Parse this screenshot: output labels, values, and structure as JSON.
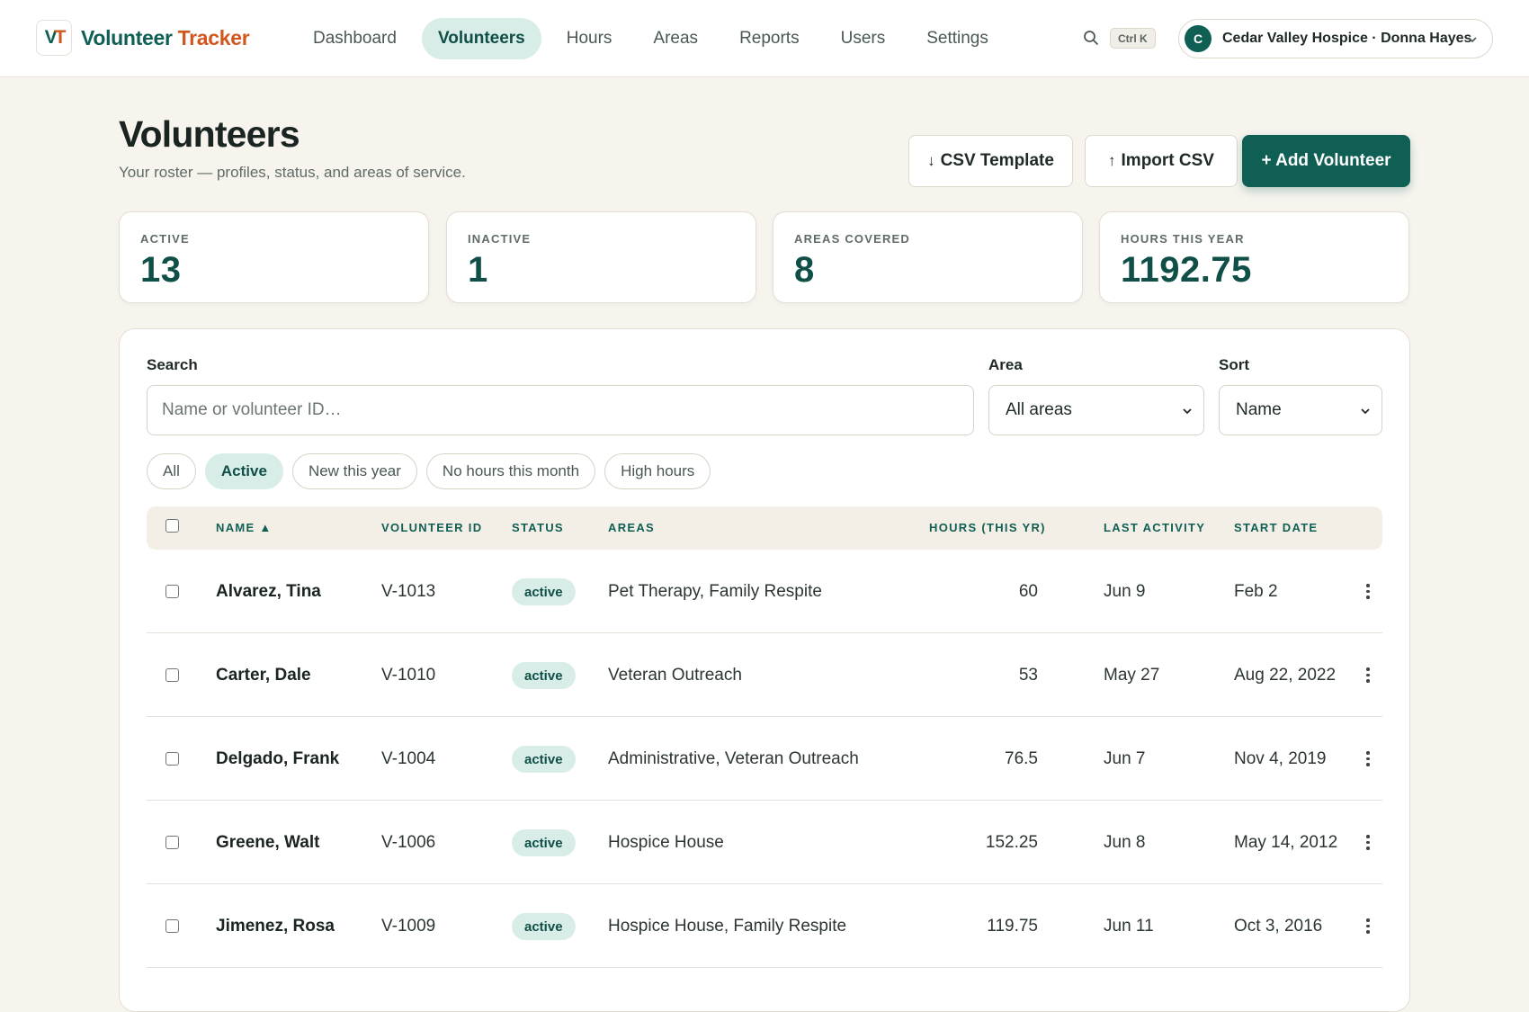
{
  "brand": {
    "logo_v": "V",
    "logo_t": "T",
    "name_a": "Volunteer",
    "name_b": "Tracker"
  },
  "nav": [
    "Dashboard",
    "Volunteers",
    "Hours",
    "Areas",
    "Reports",
    "Users",
    "Settings"
  ],
  "nav_active": "Volunteers",
  "shortcut": "Ctrl K",
  "org": {
    "initial": "C",
    "label": "Cedar Valley Hospice · Donna Hayes"
  },
  "header": {
    "title": "Volunteers",
    "subtitle": "Your roster — profiles, status, and areas of service."
  },
  "actions": {
    "csv_template": "CSV Template",
    "import_csv": "Import CSV",
    "add_volunteer": "+ Add Volunteer"
  },
  "stats": [
    {
      "label": "ACTIVE",
      "value": "13"
    },
    {
      "label": "INACTIVE",
      "value": "1"
    },
    {
      "label": "AREAS COVERED",
      "value": "8"
    },
    {
      "label": "HOURS THIS YEAR",
      "value": "1192.75"
    }
  ],
  "filters": {
    "search_label": "Search",
    "search_placeholder": "Name or volunteer ID…",
    "area_label": "Area",
    "area_value": "All areas",
    "sort_label": "Sort",
    "sort_value": "Name"
  },
  "chips": [
    "All",
    "Active",
    "New this year",
    "No hours this month",
    "High hours"
  ],
  "chip_active": "Active",
  "table": {
    "headers": {
      "name": "NAME ▲",
      "id": "VOLUNTEER ID",
      "status": "STATUS",
      "areas": "AREAS",
      "hours": "HOURS (THIS YR)",
      "last": "LAST ACTIVITY",
      "start": "START DATE"
    },
    "rows": [
      {
        "name": "Alvarez, Tina",
        "id": "V-1013",
        "status": "active",
        "areas": "Pet Therapy, Family Respite",
        "hours": "60",
        "last": "Jun 9",
        "start": "Feb 2"
      },
      {
        "name": "Carter, Dale",
        "id": "V-1010",
        "status": "active",
        "areas": "Veteran Outreach",
        "hours": "53",
        "last": "May 27",
        "start": "Aug 22, 2022"
      },
      {
        "name": "Delgado, Frank",
        "id": "V-1004",
        "status": "active",
        "areas": "Administrative, Veteran Outreach",
        "hours": "76.5",
        "last": "Jun 7",
        "start": "Nov 4, 2019"
      },
      {
        "name": "Greene, Walt",
        "id": "V-1006",
        "status": "active",
        "areas": "Hospice House",
        "hours": "152.25",
        "last": "Jun 8",
        "start": "May 14, 2012"
      },
      {
        "name": "Jimenez, Rosa",
        "id": "V-1009",
        "status": "active",
        "areas": "Hospice House, Family Respite",
        "hours": "119.75",
        "last": "Jun 11",
        "start": "Oct 3, 2016"
      }
    ]
  },
  "icons": {
    "search": "search-icon",
    "chevron": "chevron-down-icon",
    "kebab": "kebab-menu-icon",
    "download": "arrow-down-icon",
    "upload": "arrow-up-icon"
  },
  "colors": {
    "brand": "#0f5f55",
    "accent": "#d2571f",
    "badge_bg": "#d9ede8"
  }
}
